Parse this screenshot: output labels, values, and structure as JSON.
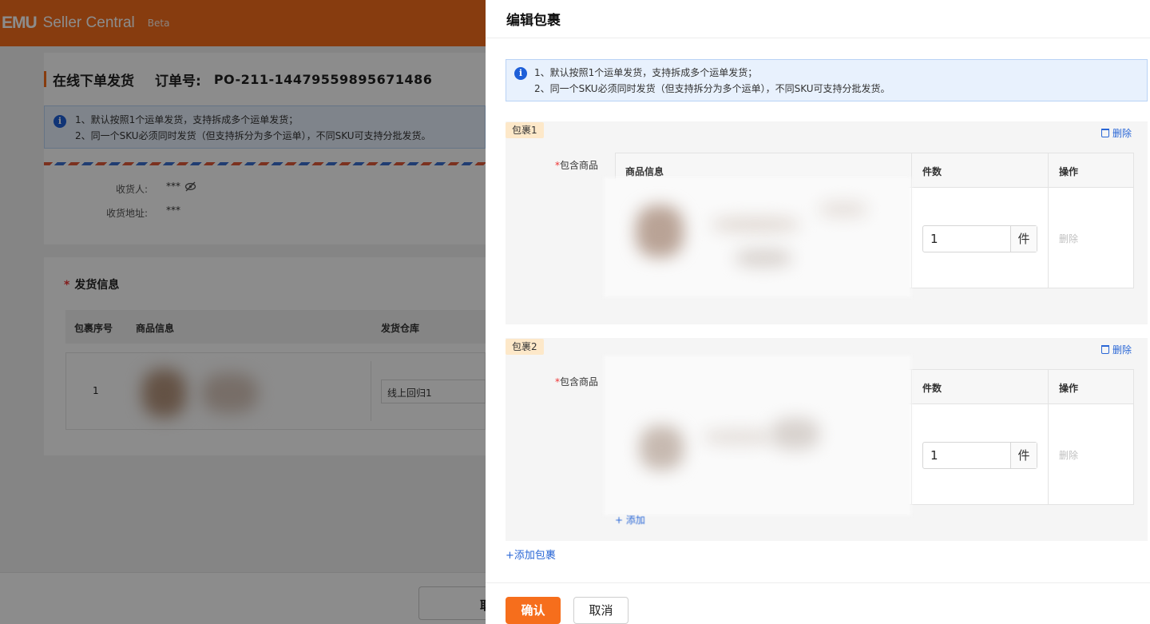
{
  "app": {
    "logo": "EMU",
    "brand": "Seller Central",
    "beta": "Beta"
  },
  "page": {
    "title": "在线下单发货",
    "order_label": "订单号:",
    "order_no": "PO-211-14479559895671486",
    "tips": [
      "1、默认按照1个运单发货，支持拆成多个运单发货；",
      "2、同一个SKU必须同时发货（但支持拆分为多个运单），不同SKU可支持分批发货。"
    ],
    "receiver_label": "收货人:",
    "receiver_value": "***",
    "address_label": "收货地址:",
    "address_value": "***",
    "shipping_section": "发货信息",
    "table_headers": [
      "包裹序号",
      "商品信息",
      "发货仓库"
    ],
    "row_index": "1",
    "warehouse": "线上回归1",
    "footer_button": "取"
  },
  "drawer": {
    "title": "编辑包裹",
    "tips": [
      "1、默认按照1个运单发货，支持拆成多个运单发货；",
      "2、同一个SKU必须同时发货（但支持拆分为多个运单），不同SKU可支持分批发货。"
    ],
    "include_label": "包含商品",
    "delete_label": "删除",
    "table_headers": {
      "product": "商品信息",
      "qty": "件数",
      "action": "操作"
    },
    "packages": [
      {
        "tag": "包裹1",
        "qty": "1",
        "unit": "件",
        "row_delete": "删除"
      },
      {
        "tag": "包裹2",
        "qty": "1",
        "unit": "件",
        "row_delete": "删除",
        "add_goods": "+ 添加"
      }
    ],
    "add_package": "+添加包裹",
    "confirm": "确认",
    "cancel": "取消"
  },
  "colors": {
    "brand": "#f66e1c",
    "link": "#2a67d6",
    "tip_bg": "#e8f1fd",
    "tag_bg": "#fde8c9"
  },
  "icons": {
    "info": "info-icon",
    "trash": "trash-icon",
    "eye_off": "eye-off-icon"
  }
}
